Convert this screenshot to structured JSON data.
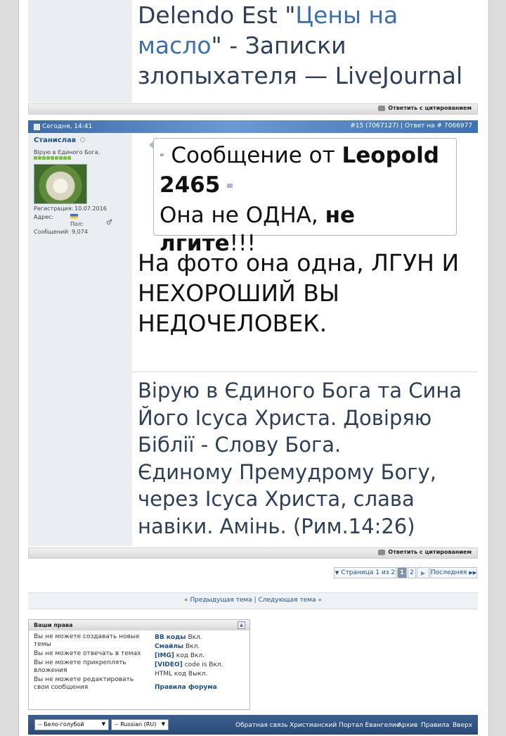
{
  "top_post": {
    "title_prefix": "Delendo Est \"",
    "title_quote": "Цены на масло",
    "title_suffix": "\" - Записки злопыхателя — LiveJournal"
  },
  "reply_label": "Ответить с цитированием",
  "post": {
    "date": "Сегодня, 14:41",
    "number": "#15 (7067127)",
    "reply_to": "Ответ на # 7066977",
    "user": {
      "name": "Станислав",
      "title": "Вірую в Єдиного Бога.",
      "reg_label": "Регистрация:",
      "reg_value": "10.07.2016",
      "addr_label": "Адрес:",
      "sex_label": "Пол:",
      "msgs_label": "Сообщений:",
      "msgs_value": "9,074"
    },
    "quote": {
      "intro": "Сообщение от ",
      "author": "Leopold 2465",
      "text_before": "Она не ОДНА, ",
      "text_bold": "не лгите",
      "text_after": "!!!"
    },
    "body": "На фото она одна, ЛГУН И НЕХОРОШИЙ ВЫ НЕДОЧЕЛОВЕК.",
    "signature": [
      "Вірую в Єдиного Бога та Сина",
      "Його Ісуса Христа. Довіряю",
      "Біблії - Слову Бога.",
      "Єдиному Премудрому Богу,",
      "через Ісуса Христа, слава",
      "навіки. Амінь. (Рим.14:26)"
    ]
  },
  "pagination": {
    "label": "Страница 1 из 2",
    "current": "1",
    "next": "2",
    "last": "Последняя"
  },
  "thread_nav": {
    "prev": "Предыдущая тема",
    "sep": "|",
    "next": "Следующая тема",
    "left_mark": "«",
    "right_mark": "»"
  },
  "permissions": {
    "title": "Ваши права",
    "left": [
      "Вы не можете создавать новые темы",
      "Вы не можете отвечать в темах",
      "Вы не можете прикреплять вложения",
      "Вы не можете редактировать свои сообщения"
    ],
    "bb_label": "BB коды",
    "bb_value": "Вкл.",
    "smilies_label": "Смайлы",
    "smilies_value": "Вкл.",
    "img_label": "[IMG]",
    "img_value": "код Вкл.",
    "video_label": "[VIDEO]",
    "video_value": "code is Вкл.",
    "html_value": "HTML код Выкл.",
    "rules_label": "Правила форума"
  },
  "footer": {
    "style_select": "-- Бело-голубой",
    "lang_select": "-- Russian (RU)",
    "links": [
      "Обратная связь",
      "Христианский Портал Евангелие",
      "Архив",
      "Правила",
      "Вверх"
    ]
  }
}
